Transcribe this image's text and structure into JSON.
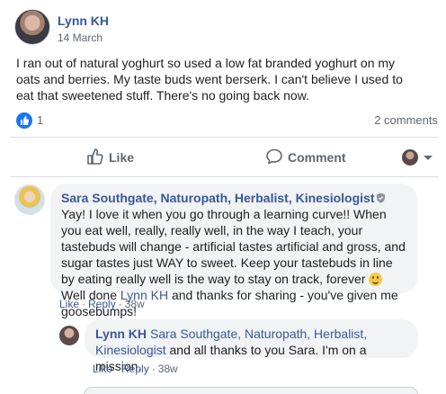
{
  "post": {
    "author": "Lynn KH",
    "date": "14 March",
    "text": "I ran out of natural yoghurt so used a low fat branded yoghurt on my oats and berries. My taste buds went berserk. I can't believe I used to eat that sweetened stuff. There's no going back now.",
    "like_count": "1",
    "comments_count": "2 comments"
  },
  "actions": {
    "like_label": "Like",
    "comment_label": "Comment"
  },
  "comments": [
    {
      "author": "Sara Southgate, Naturopath, Herbalist, Kinesiologist",
      "text_before_smile": "Yay! I love it when you go through a learning curve!! When you eat well, really, really well, in the way I teach, your tastebuds will change - artificial tastes artificial and gross, and sugar tastes just WAY to sweet. Keep your tastebuds in line by eating really well is the way to stay on track, forever ",
      "text_after_smile": "Well done ",
      "mention": "Lynn KH",
      "text_end": " and thanks for sharing - you've given me goosebumps!",
      "like": "Like",
      "reply": "Reply",
      "time": "38w"
    },
    {
      "author": "Lynn KH",
      "mention": "Sara Southgate, Naturopath, Herbalist, Kinesiologist",
      "text": " and all thanks to you Sara. I'm on a mission.",
      "like": "Like",
      "reply": "Reply",
      "time": "38w"
    }
  ],
  "colors": {
    "link": "#385898",
    "like_badge": "#1877f2",
    "bubble": "#f2f3f5"
  }
}
